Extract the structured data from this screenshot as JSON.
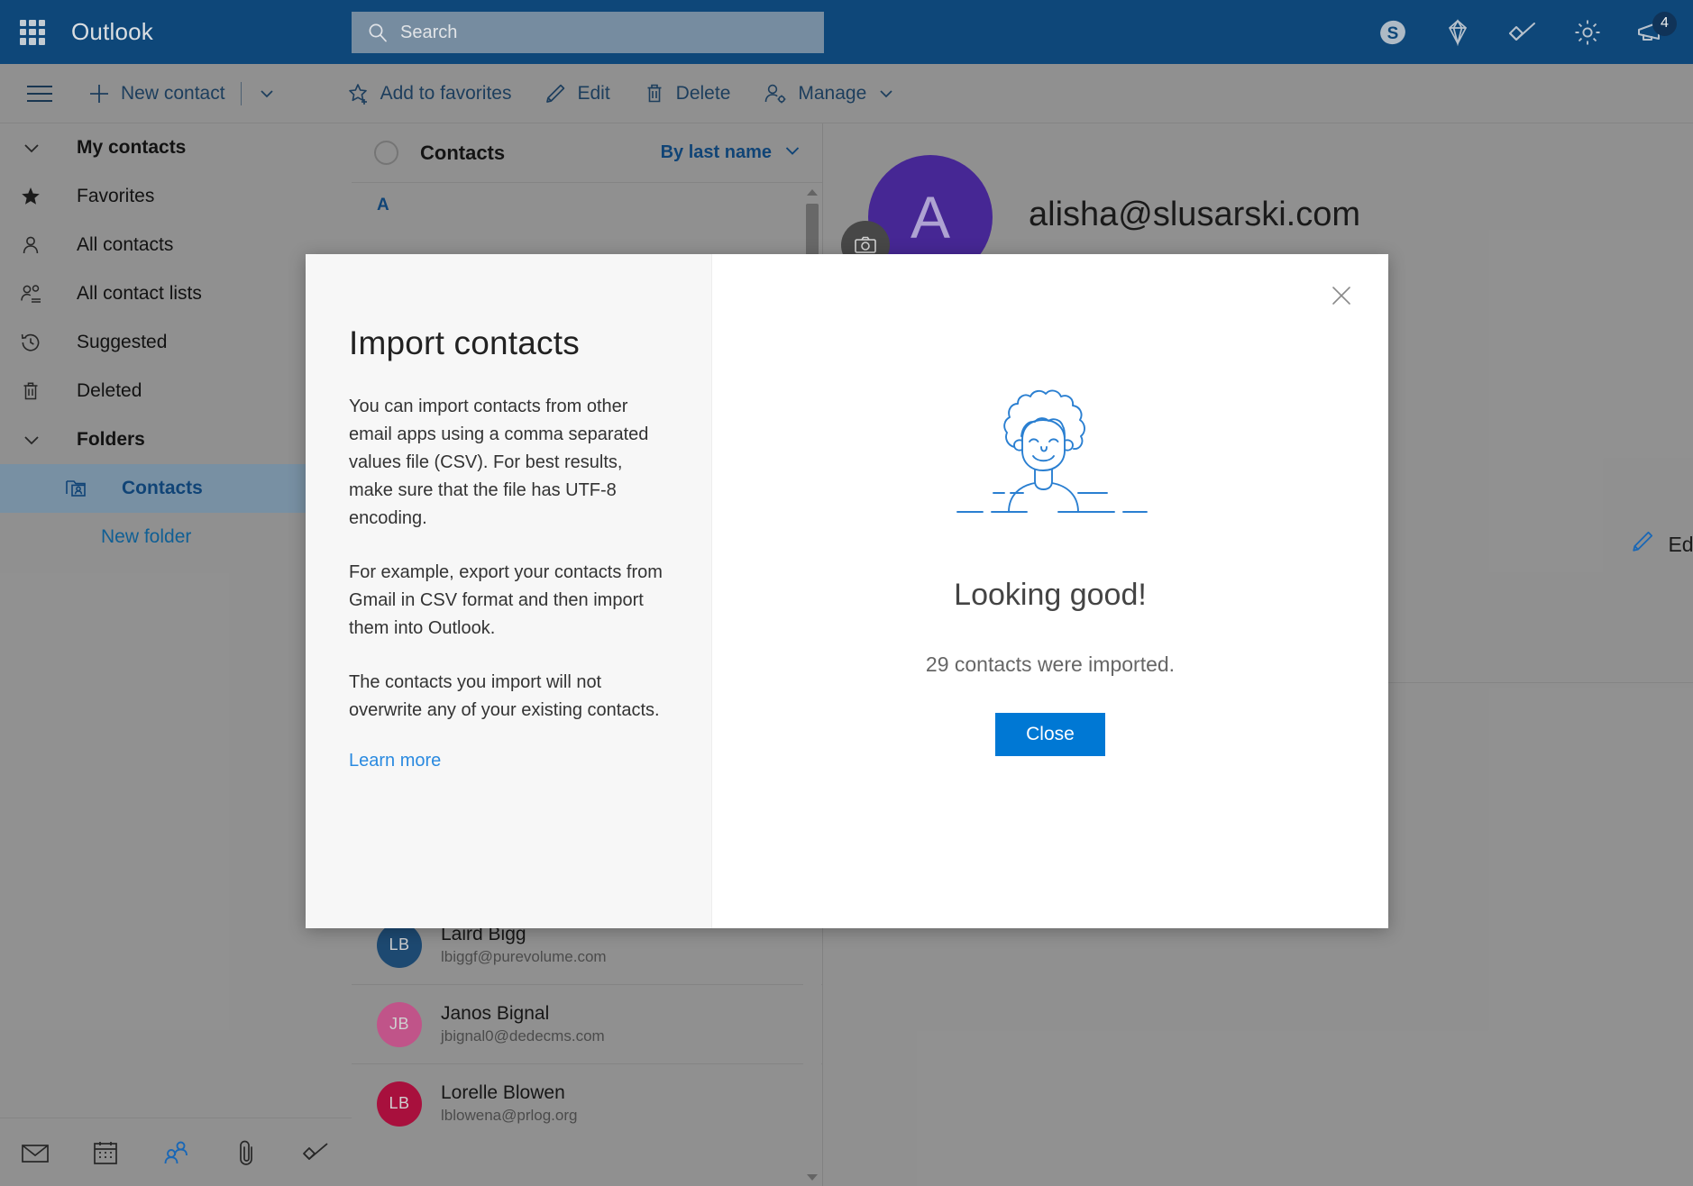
{
  "topbar": {
    "brand": "Outlook",
    "waffle_icon": "app-launcher-icon",
    "search": {
      "placeholder": "Search",
      "value": "",
      "icon": "search-icon"
    },
    "icons": [
      {
        "name": "skype-icon",
        "label": "Skype"
      },
      {
        "name": "diamond-icon",
        "label": "Premium"
      },
      {
        "name": "todo-icon",
        "label": "To Do"
      },
      {
        "name": "gear-icon",
        "label": "Settings"
      },
      {
        "name": "megaphone-icon",
        "label": "What's new",
        "badge": "4"
      }
    ]
  },
  "commandbar": {
    "hamburger_icon": "hamburger-menu-icon",
    "new_contact": {
      "label": "New contact",
      "icon": "plus-icon",
      "caret": "chevron-down-icon"
    },
    "actions": [
      {
        "label": "Add to favorites",
        "icon": "star-add-icon"
      },
      {
        "label": "Edit",
        "icon": "pencil-icon"
      },
      {
        "label": "Delete",
        "icon": "trash-icon"
      },
      {
        "label": "Manage",
        "icon": "person-gear-icon",
        "caret": "chevron-down-icon"
      }
    ]
  },
  "sidebar": {
    "items": [
      {
        "label": "My contacts",
        "icon": "chevron-down-icon",
        "type": "group"
      },
      {
        "label": "Favorites",
        "icon": "star-icon",
        "type": "item"
      },
      {
        "label": "All contacts",
        "icon": "person-icon",
        "type": "item"
      },
      {
        "label": "All contact lists",
        "icon": "people-list-icon",
        "type": "item"
      },
      {
        "label": "Suggested",
        "icon": "history-icon",
        "type": "item"
      },
      {
        "label": "Deleted",
        "icon": "trash-icon",
        "type": "item"
      },
      {
        "label": "Folders",
        "icon": "chevron-down-icon",
        "type": "group"
      },
      {
        "label": "Contacts",
        "icon": "contacts-folder-icon",
        "type": "child",
        "selected": true
      },
      {
        "label": "New folder",
        "icon": "",
        "type": "link"
      }
    ],
    "bottom_nav": [
      {
        "name": "mail-icon",
        "label": "Mail",
        "active": false
      },
      {
        "name": "calendar-icon",
        "label": "Calendar",
        "active": false
      },
      {
        "name": "people-icon",
        "label": "People",
        "active": true
      },
      {
        "name": "files-icon",
        "label": "Files",
        "active": false
      },
      {
        "name": "todo-icon",
        "label": "To Do",
        "active": false
      }
    ]
  },
  "list": {
    "select_all_icon": "selection-circle-icon",
    "title": "Contacts",
    "sort_label": "By last name",
    "sort_caret": "chevron-down-icon",
    "alpha_header": "A",
    "scrollbar": {
      "up_icon": "caret-up-icon",
      "down_icon": "caret-down-icon"
    },
    "contacts": [
      {
        "initials": "LB",
        "name": "Laird Bigg",
        "email": "lbiggf@purevolume.com",
        "color": "#1f4e79"
      },
      {
        "initials": "JB",
        "name": "Janos Bignal",
        "email": "jbignal0@dedecms.com",
        "color": "#cc5a92"
      },
      {
        "initials": "LB",
        "name": "Lorelle Blowen",
        "email": "lblowena@prlog.org",
        "color": "#b31241"
      }
    ]
  },
  "detail": {
    "avatar_initial": "A",
    "avatar_color": "#4b2a9e",
    "camera_icon": "camera-icon",
    "email": "alisha@slusarski.com",
    "edit_contact": {
      "label": "Edit c",
      "icon": "pencil-icon"
    }
  },
  "modal": {
    "close_icon": "close-icon",
    "left": {
      "title": "Import contacts",
      "paragraphs": [
        "You can import contacts from other email apps using a comma separated values file (CSV). For best results, make sure that the file has UTF-8 encoding.",
        "For example, export your contacts from Gmail in CSV format and then import them into Outlook.",
        "The contacts you import will not overwrite any of your existing contacts."
      ],
      "learn_more": "Learn more"
    },
    "right": {
      "illustration_icon": "person-smiling-illustration",
      "headline": "Looking good!",
      "subline": "29 contacts were imported.",
      "button_label": "Close",
      "button_color": "#0078d4"
    }
  }
}
